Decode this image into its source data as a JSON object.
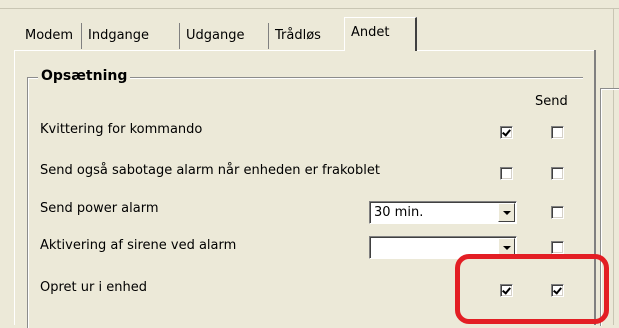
{
  "tabs": [
    {
      "label": "Modem",
      "active": false
    },
    {
      "label": "Indgange",
      "active": false
    },
    {
      "label": "Udgange",
      "active": false
    },
    {
      "label": "Trådløs",
      "active": false
    },
    {
      "label": "Andet",
      "active": true
    }
  ],
  "group": {
    "title": "Opsætning",
    "send_header": "Send"
  },
  "rows": [
    {
      "label": "Kvittering for kommando",
      "checked": true,
      "send_checked": false
    },
    {
      "label": "Send også sabotage alarm når enheden er frakoblet",
      "checked": false,
      "send_checked": false
    },
    {
      "label": "Send power alarm",
      "combo_value": "30 min.",
      "send_checked": false
    },
    {
      "label": "Aktivering af sirene ved alarm",
      "combo_value": "",
      "send_checked": false
    },
    {
      "label": "Opret ur i enhed",
      "checked": true,
      "send_checked": true
    }
  ],
  "colors": {
    "window_bg": "#ece9d8",
    "highlight": "#e31e24"
  },
  "icons": {
    "combo_button": "chevron-down-icon",
    "checkbox_mark": "check-icon"
  }
}
